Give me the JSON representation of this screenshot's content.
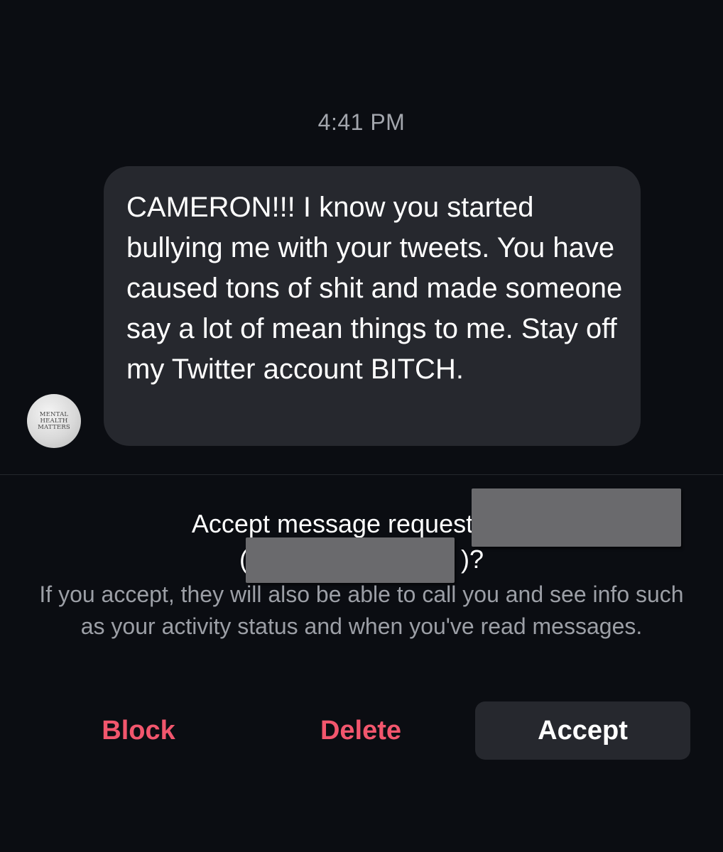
{
  "thread": {
    "timestamp": "4:41 PM"
  },
  "message": {
    "sender_avatar_text": "MENTAL HEALTH MATTERS",
    "text": "CAMERON!!! I know you started bullying me with your tweets. You have caused tons of shit and made someone say a lot of mean things to me. Stay off my Twitter account BITCH."
  },
  "request": {
    "title_prefix": "Accept message request from ",
    "title_name_open": "(",
    "title_suffix": ")?",
    "info": "If you accept, they will also be able to call you and see info such as your activity status and when you've read messages."
  },
  "actions": {
    "block_label": "Block",
    "delete_label": "Delete",
    "accept_label": "Accept"
  },
  "colors": {
    "background": "#0b0d12",
    "bubble": "#26282e",
    "destructive": "#f2566d",
    "secondary_text": "#9c9fa6"
  }
}
